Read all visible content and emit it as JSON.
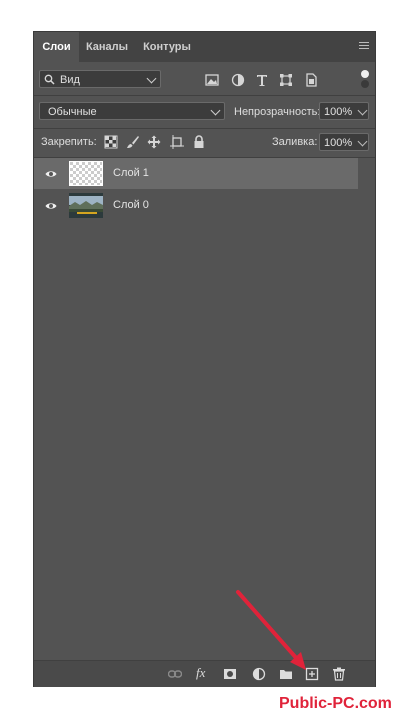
{
  "tabs": [
    {
      "label": "Слои",
      "active": true
    },
    {
      "label": "Каналы",
      "active": false
    },
    {
      "label": "Контуры",
      "active": false
    }
  ],
  "filter": {
    "label": "Вид"
  },
  "blend_mode": {
    "value": "Обычные"
  },
  "opacity": {
    "label": "Непрозрачность:",
    "value": "100%"
  },
  "lock": {
    "label": "Закрепить:"
  },
  "fill": {
    "label": "Заливка:",
    "value": "100%"
  },
  "layers": [
    {
      "name": "Слой 1",
      "selected": true,
      "visible": true
    },
    {
      "name": "Слой 0",
      "selected": false,
      "visible": true
    }
  ],
  "bottom_toolbar": [
    "link-icon",
    "fx-icon",
    "mask-icon",
    "adjustment-icon",
    "group-folder-icon",
    "new-layer-icon",
    "trash-icon"
  ],
  "fx_label": "fx",
  "watermark": "Public-PC.com",
  "colors": {
    "panel": "#535353",
    "accent": "#e0233a"
  }
}
